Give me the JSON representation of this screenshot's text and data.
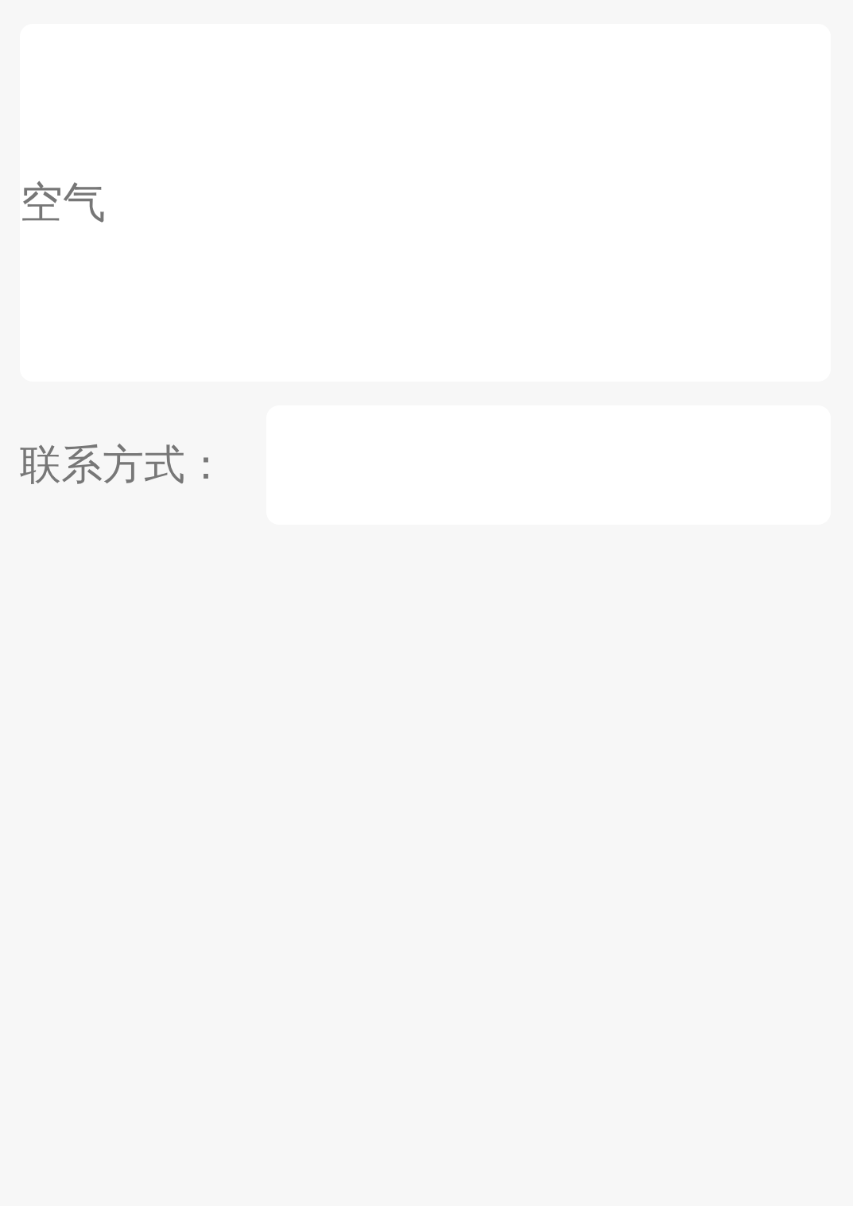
{
  "message_field": {
    "value": "空气"
  },
  "contact": {
    "label": "联系方式："
  }
}
